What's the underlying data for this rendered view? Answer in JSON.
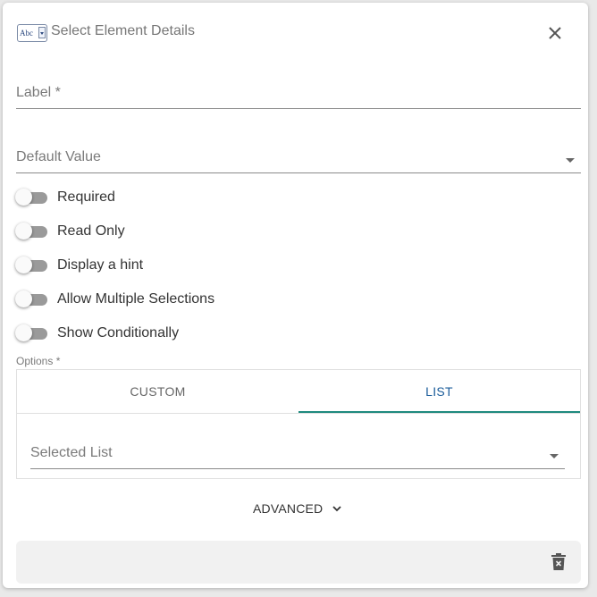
{
  "dialog": {
    "title": "Select Element Details",
    "icon_text": "Abc",
    "close_icon": "close-icon"
  },
  "fields": {
    "label": "Label *",
    "default_value": "Default Value"
  },
  "toggles": [
    {
      "label": "Required",
      "on": false
    },
    {
      "label": "Read Only",
      "on": false
    },
    {
      "label": "Display a hint",
      "on": false
    },
    {
      "label": "Allow Multiple Selections",
      "on": false
    },
    {
      "label": "Show Conditionally",
      "on": false
    }
  ],
  "options": {
    "label": "Options *",
    "tabs": [
      {
        "label": "CUSTOM",
        "active": false
      },
      {
        "label": "LIST",
        "active": true
      }
    ],
    "selected_list_label": "Selected List"
  },
  "advanced": {
    "label": "ADVANCED",
    "icon": "chevron-down-icon"
  },
  "footer": {
    "delete_icon": "trash-icon"
  },
  "colors": {
    "accent": "#1f8a7e",
    "active_tab_text": "#1a5c9a",
    "toggle_track": "#9a9a9a",
    "footer_bg": "#f1f1f1"
  }
}
